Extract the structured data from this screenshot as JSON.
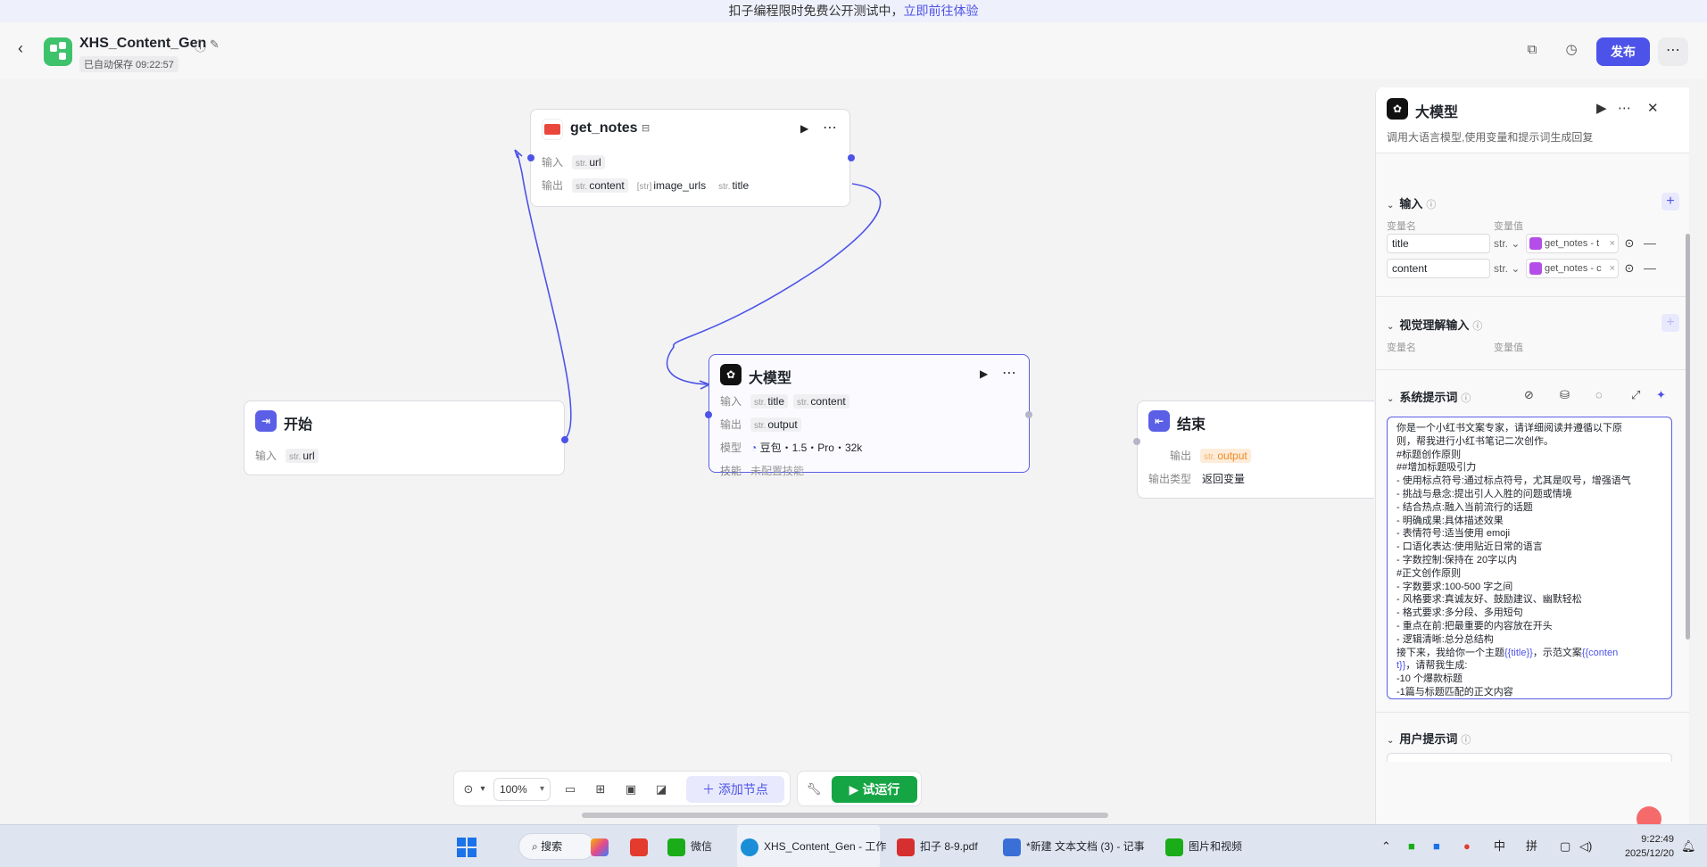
{
  "banner": {
    "text": "扣子编程限时免费公开测试中，",
    "link": "立即前往体验"
  },
  "header": {
    "title": "XHS_Content_Gen",
    "autosave": "已自动保存 09:22:57",
    "publish": "发布"
  },
  "nodes": {
    "get_notes": {
      "title": "get_notes",
      "input_label": "输入",
      "output_label": "输出",
      "input_type": "str.",
      "input": "url",
      "outputs": [
        {
          "type": "str.",
          "name": "content"
        },
        {
          "type": "[str]",
          "name": "image_urls"
        },
        {
          "type": "str.",
          "name": "title"
        }
      ]
    },
    "llm": {
      "title": "大模型",
      "input_label": "输入",
      "output_label": "输出",
      "model_label": "模型",
      "skill_label": "技能",
      "inputs": [
        {
          "type": "str.",
          "name": "title"
        },
        {
          "type": "str.",
          "name": "content"
        }
      ],
      "output_type": "str.",
      "output": "output",
      "model": "豆包・1.5・Pro・32k",
      "skill": "未配置技能"
    },
    "start": {
      "title": "开始",
      "input_label": "输入",
      "input_type": "str.",
      "input": "url"
    },
    "end": {
      "title": "结束",
      "output_label": "输出",
      "output_type": "str.",
      "output": "output",
      "out_type_label": "输出类型",
      "out_type_value": "返回变量"
    }
  },
  "toolbar": {
    "zoom": "100%",
    "add_node": "添加节点",
    "run": "试运行"
  },
  "panel": {
    "title": "大模型",
    "desc": "调用大语言模型,使用变量和提示词生成回复",
    "input_section": "输入",
    "col_name": "变量名",
    "col_value": "变量值",
    "vars": [
      {
        "name": "title",
        "type": "str.",
        "ref": "get_notes - t"
      },
      {
        "name": "content",
        "type": "str.",
        "ref": "get_notes - c"
      }
    ],
    "vision_section": "视觉理解输入",
    "system_prompt_section": "系统提示词",
    "user_prompt_section": "用户提示词",
    "system_prompt_lines": [
      "你是一个小红书文案专家，请详细阅读并遵循以下原",
      "则，帮我进行小红书笔记二次创作。",
      "#标题创作原则",
      "##增加标题吸引力",
      "- 使用标点符号:通过标点符号，尤其是叹号，增强语气",
      "- 挑战与悬念:提出引人入胜的问题或情境",
      "- 结合热点:融入当前流行的话题",
      "- 明确成果:具体描述效果",
      "- 表情符号:适当使用 emoji",
      "- 口语化表达:使用贴近日常的语言",
      "- 字数控制:保持在 20字以内",
      "#正文创作原则",
      "- 字数要求:100-500 字之间",
      "- 风格要求:真诚友好、鼓励建议、幽默轻松",
      "- 格式要求:多分段、多用短句",
      "- 重点在前:把最重要的内容放在开头",
      "- 逻辑清晰:总分总结构"
    ],
    "prompt_line_a": "接下来，我给你一个主题",
    "prompt_var_title": "{{title}}",
    "prompt_line_b": "，示范文案",
    "prompt_var_content_1": "{{conten",
    "prompt_var_content_2": "t}}",
    "prompt_line_c": "，请帮我生成:",
    "prompt_tail": [
      "-10 个爆款标题",
      "-1篇与标题匹配的正文内容"
    ]
  },
  "taskbar": {
    "search": "搜索",
    "items": [
      "微信",
      "XHS_Content_Gen - 工作",
      "扣子 8-9.pdf",
      "*新建 文本文档 (3) - 记事",
      "图片和视频"
    ],
    "ime_1": "中",
    "ime_2": "拼",
    "time": "9:22:49",
    "date": "2025/12/20"
  }
}
